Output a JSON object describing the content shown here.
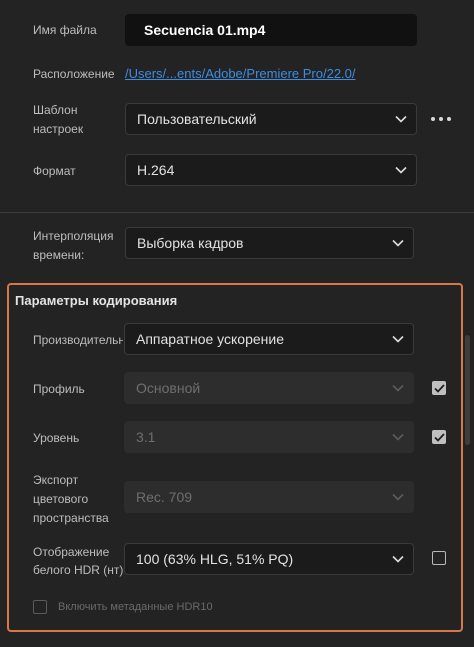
{
  "file_name": {
    "label": "Имя файла",
    "value": "Secuencia 01.mp4"
  },
  "location": {
    "label": "Расположение",
    "value": "/Users/...ents/Adobe/Premiere Pro/22.0/"
  },
  "preset": {
    "label_line1": "Шаблон",
    "label_line2": "настроек",
    "value": "Пользовательский"
  },
  "format": {
    "label": "Формат",
    "value": "H.264"
  },
  "interpolation": {
    "label_line1": "Интерполяция",
    "label_line2": "времени:",
    "value": "Выборка кадров"
  },
  "encoding": {
    "title": "Параметры кодирования",
    "performance": {
      "label": "Производительность",
      "value": "Аппаратное ускорение"
    },
    "profile": {
      "label": "Профиль",
      "value": "Основной",
      "checked": true
    },
    "level": {
      "label": "Уровень",
      "value": "3.1",
      "checked": true
    },
    "color_space": {
      "label_line1": "Экспорт",
      "label_line2": "цветового",
      "label_line3": "пространства",
      "value": "Rec. 709"
    },
    "hdr_white": {
      "label_line1": "Отображение",
      "label_line2": "белого HDR (нт)",
      "value": "100 (63% HLG, 51% PQ)",
      "checked": false
    },
    "hdr10_metadata": {
      "label": "Включить метаданные HDR10",
      "checked": false
    }
  },
  "icons": {
    "dropdown": "chevron-down-icon",
    "more": "more-horizontal-icon",
    "check": "check-icon"
  }
}
